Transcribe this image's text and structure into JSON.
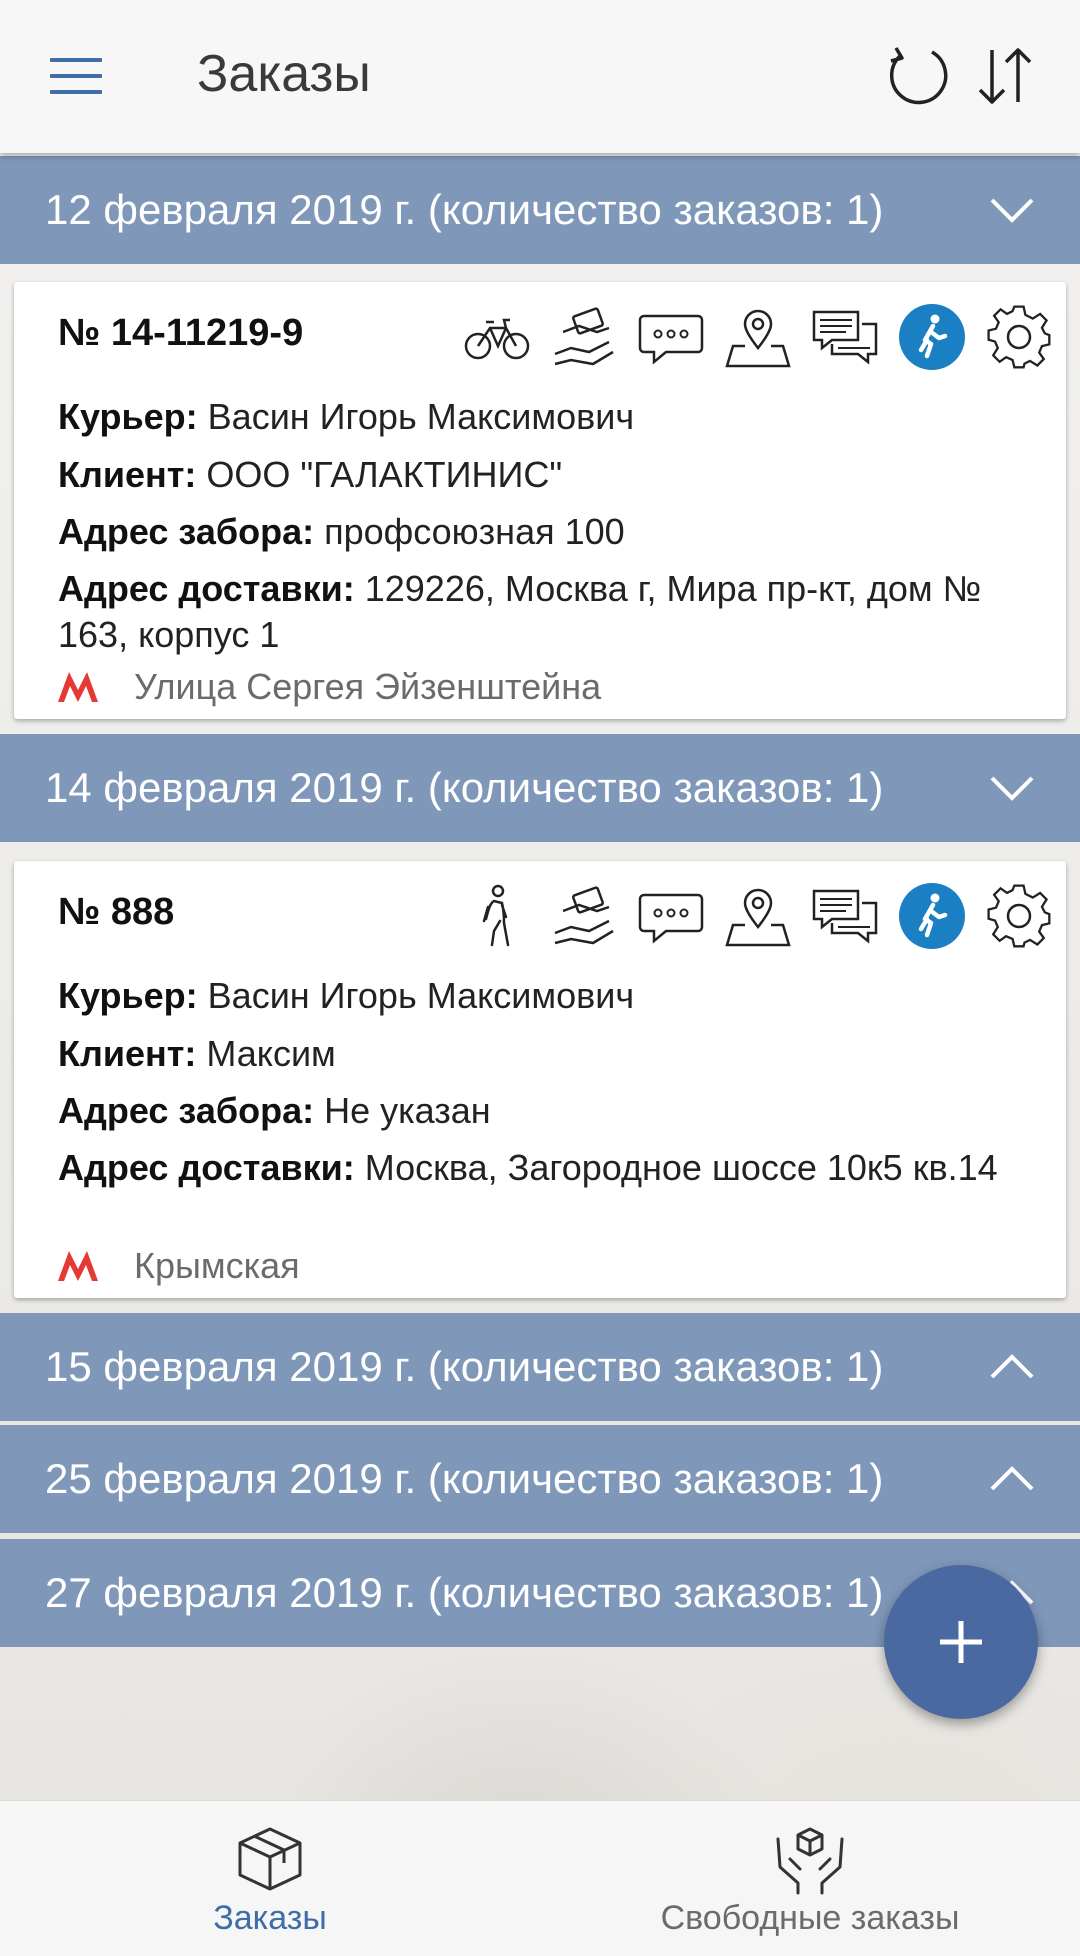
{
  "app": {
    "title": "Заказы"
  },
  "date_groups": [
    {
      "label": "12 февраля 2019 г. (количество заказов: 1)",
      "expanded": true
    },
    {
      "label": "14 февраля 2019 г. (количество заказов: 1)",
      "expanded": true
    },
    {
      "label": "15 февраля 2019 г. (количество заказов: 1)",
      "expanded": false
    },
    {
      "label": "25 февраля 2019 г. (количество заказов: 1)",
      "expanded": false
    },
    {
      "label": "27 февраля 2019 г. (количество заказов: 1)",
      "expanded": false
    }
  ],
  "orders": [
    {
      "number": "№ 14-11219-9",
      "transport_icon": "bicycle-icon",
      "courier_label": "Курьер:",
      "courier": "Васин Игорь Максимович",
      "client_label": "Клиент:",
      "client": "ООО \"ГАЛАКТИНИС\"",
      "pickup_label": "Адрес забора:",
      "pickup": "профсоюзная 100",
      "delivery_label": "Адрес доставки:",
      "delivery": "129226, Москва г, Мира пр-кт, дом № 163, корпус 1",
      "metro": "Улица Сергея Эйзенштейна"
    },
    {
      "number": "№ 888",
      "transport_icon": "walking-person-icon",
      "courier_label": "Курьер:",
      "courier": "Васин Игорь Максимович",
      "client_label": "Клиент:",
      "client": "Максим",
      "pickup_label": "Адрес забора:",
      "pickup": "Не указан",
      "delivery_label": "Адрес доставки:",
      "delivery": "Москва, Загородное шоссе 10к5 кв.14",
      "metro": "Крымская"
    }
  ],
  "bottom_nav": {
    "orders_label": "Заказы",
    "free_orders_label": "Свободные заказы"
  },
  "colors": {
    "header_bg": "#7f97b9",
    "accent": "#3d6ea8",
    "status_blue": "#1b7fc4",
    "fab": "#4a69a0",
    "metro_red": "#e53935"
  }
}
